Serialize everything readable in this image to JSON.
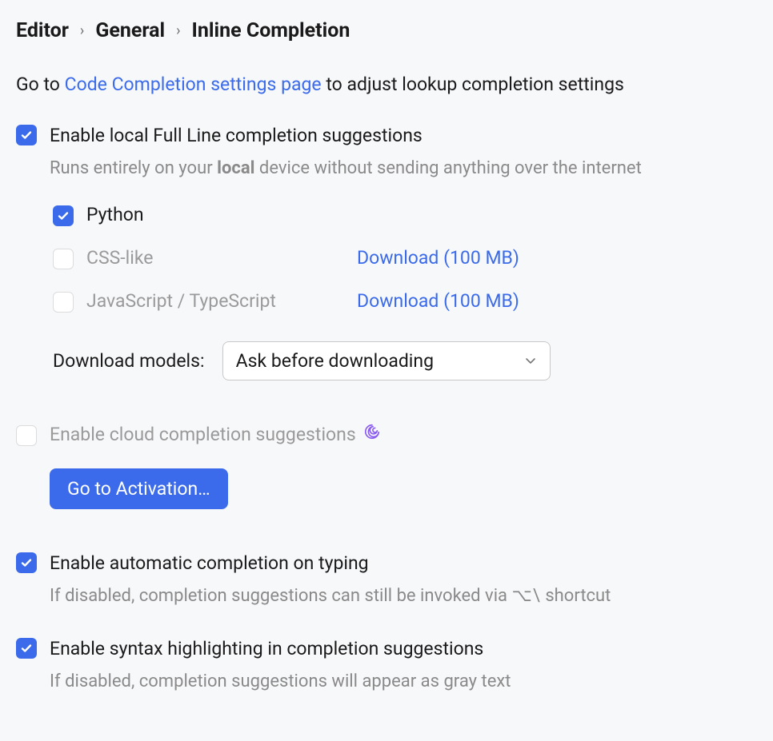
{
  "breadcrumb": {
    "item1": "Editor",
    "item2": "General",
    "item3": "Inline Completion"
  },
  "intro": {
    "prefix": "Go to ",
    "link": "Code Completion settings page",
    "suffix": " to adjust lookup completion settings"
  },
  "fullLine": {
    "label": "Enable local Full Line completion suggestions",
    "helper_pre": "Runs entirely on your ",
    "helper_bold": "local",
    "helper_post": " device without sending anything over the internet",
    "languages": {
      "python": {
        "label": "Python"
      },
      "css": {
        "label": "CSS-like",
        "download": "Download (100 MB)"
      },
      "jsts": {
        "label": "JavaScript / TypeScript",
        "download": "Download (100 MB)"
      }
    },
    "models_label": "Download models:",
    "models_value": "Ask before downloading"
  },
  "cloud": {
    "label": "Enable cloud completion suggestions",
    "button": "Go to Activation…"
  },
  "auto": {
    "label": "Enable automatic completion on typing",
    "helper_pre": "If disabled, completion suggestions can still be invoked via ",
    "shortcut": "⌥\\",
    "helper_post": " shortcut"
  },
  "syntax": {
    "label": "Enable syntax highlighting in completion suggestions",
    "helper": "If disabled, completion suggestions will appear as gray text"
  }
}
